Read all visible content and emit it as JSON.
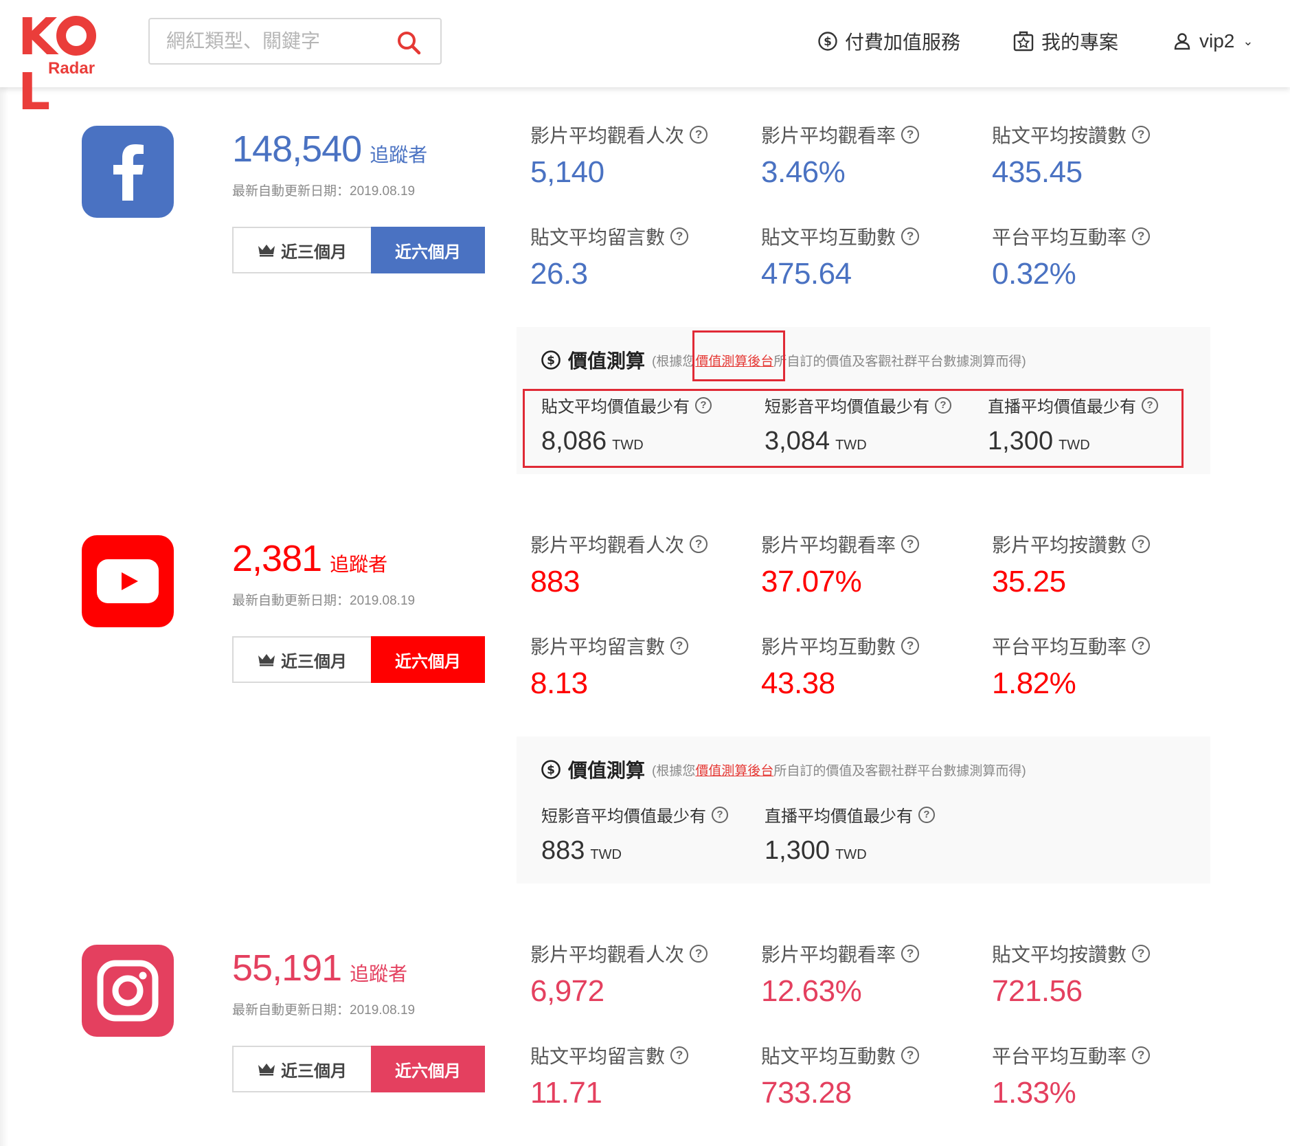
{
  "header": {
    "logo_text": "KOL",
    "logo_sub": "Radar",
    "search_placeholder": "網紅類型、關鍵字",
    "nav_paid": "付費加值服務",
    "nav_projects": "我的專案",
    "nav_user": "vip2"
  },
  "common": {
    "followers_unit": "追蹤者",
    "period_3m": "近三個月",
    "period_6m": "近六個月",
    "value_title": "價值測算",
    "value_note_before": "(根據您",
    "value_note_link": "價值測算後台",
    "value_note_after": "所自訂的價值及客觀社群平台數據測算而得)",
    "currency": "TWD"
  },
  "facebook": {
    "color": "#4a72c2",
    "icon": "facebook-icon",
    "followers": "148,540",
    "updated": "最新自動更新日期：2019.08.19",
    "stats": [
      {
        "label": "影片平均觀看人次",
        "value": "5,140"
      },
      {
        "label": "影片平均觀看率",
        "value": "3.46%"
      },
      {
        "label": "貼文平均按讚數",
        "value": "435.45"
      },
      {
        "label": "貼文平均留言數",
        "value": "26.3"
      },
      {
        "label": "貼文平均互動數",
        "value": "475.64"
      },
      {
        "label": "平台平均互動率",
        "value": "0.32%"
      }
    ],
    "value_items": [
      {
        "label": "貼文平均價值最少有",
        "value": "8,086"
      },
      {
        "label": "短影音平均價值最少有",
        "value": "3,084"
      },
      {
        "label": "直播平均價值最少有",
        "value": "1,300"
      }
    ]
  },
  "youtube": {
    "color": "#ff0000",
    "icon": "youtube-icon",
    "followers": "2,381",
    "updated": "最新自動更新日期：2019.08.19",
    "stats": [
      {
        "label": "影片平均觀看人次",
        "value": "883"
      },
      {
        "label": "影片平均觀看率",
        "value": "37.07%"
      },
      {
        "label": "影片平均按讚數",
        "value": "35.25"
      },
      {
        "label": "影片平均留言數",
        "value": "8.13"
      },
      {
        "label": "影片平均互動數",
        "value": "43.38"
      },
      {
        "label": "平台平均互動率",
        "value": "1.82%"
      }
    ],
    "value_items": [
      {
        "label": "短影音平均價值最少有",
        "value": "883"
      },
      {
        "label": "直播平均價值最少有",
        "value": "1,300"
      }
    ]
  },
  "instagram": {
    "color": "#e4405f",
    "icon": "instagram-icon",
    "followers": "55,191",
    "updated": "最新自動更新日期：2019.08.19",
    "stats": [
      {
        "label": "影片平均觀看人次",
        "value": "6,972"
      },
      {
        "label": "影片平均觀看率",
        "value": "12.63%"
      },
      {
        "label": "貼文平均按讚數",
        "value": "721.56"
      },
      {
        "label": "貼文平均留言數",
        "value": "11.71"
      },
      {
        "label": "貼文平均互動數",
        "value": "733.28"
      },
      {
        "label": "平台平均互動率",
        "value": "1.33%"
      }
    ]
  }
}
